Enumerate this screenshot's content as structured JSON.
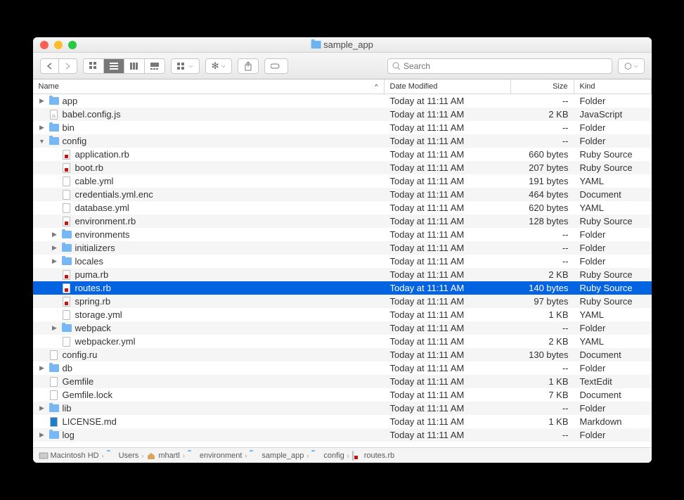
{
  "title": "sample_app",
  "search_placeholder": "Search",
  "columns": {
    "name": "Name",
    "date": "Date Modified",
    "size": "Size",
    "kind": "Kind"
  },
  "path": [
    {
      "label": "Macintosh HD",
      "icon": "disk"
    },
    {
      "label": "Users",
      "icon": "folder"
    },
    {
      "label": "mhartl",
      "icon": "home"
    },
    {
      "label": "environment",
      "icon": "folder"
    },
    {
      "label": "sample_app",
      "icon": "folder"
    },
    {
      "label": "config",
      "icon": "folder"
    },
    {
      "label": "routes.rb",
      "icon": "ruby"
    }
  ],
  "files": [
    {
      "depth": 0,
      "disc": "right",
      "icon": "folder",
      "name": "app",
      "date": "Today at 11:11 AM",
      "size": "--",
      "kind": "Folder"
    },
    {
      "depth": 0,
      "disc": "",
      "icon": "js",
      "name": "babel.config.js",
      "date": "Today at 11:11 AM",
      "size": "2 KB",
      "kind": "JavaScript"
    },
    {
      "depth": 0,
      "disc": "right",
      "icon": "folder",
      "name": "bin",
      "date": "Today at 11:11 AM",
      "size": "--",
      "kind": "Folder"
    },
    {
      "depth": 0,
      "disc": "down",
      "icon": "folder",
      "name": "config",
      "date": "Today at 11:11 AM",
      "size": "--",
      "kind": "Folder"
    },
    {
      "depth": 1,
      "disc": "",
      "icon": "ruby",
      "name": "application.rb",
      "date": "Today at 11:11 AM",
      "size": "660 bytes",
      "kind": "Ruby Source"
    },
    {
      "depth": 1,
      "disc": "",
      "icon": "ruby",
      "name": "boot.rb",
      "date": "Today at 11:11 AM",
      "size": "207 bytes",
      "kind": "Ruby Source"
    },
    {
      "depth": 1,
      "disc": "",
      "icon": "file",
      "name": "cable.yml",
      "date": "Today at 11:11 AM",
      "size": "191 bytes",
      "kind": "YAML"
    },
    {
      "depth": 1,
      "disc": "",
      "icon": "file",
      "name": "credentials.yml.enc",
      "date": "Today at 11:11 AM",
      "size": "464 bytes",
      "kind": "Document"
    },
    {
      "depth": 1,
      "disc": "",
      "icon": "file",
      "name": "database.yml",
      "date": "Today at 11:11 AM",
      "size": "620 bytes",
      "kind": "YAML"
    },
    {
      "depth": 1,
      "disc": "",
      "icon": "ruby",
      "name": "environment.rb",
      "date": "Today at 11:11 AM",
      "size": "128 bytes",
      "kind": "Ruby Source"
    },
    {
      "depth": 1,
      "disc": "right",
      "icon": "folder",
      "name": "environments",
      "date": "Today at 11:11 AM",
      "size": "--",
      "kind": "Folder"
    },
    {
      "depth": 1,
      "disc": "right",
      "icon": "folder",
      "name": "initializers",
      "date": "Today at 11:11 AM",
      "size": "--",
      "kind": "Folder"
    },
    {
      "depth": 1,
      "disc": "right",
      "icon": "folder",
      "name": "locales",
      "date": "Today at 11:11 AM",
      "size": "--",
      "kind": "Folder"
    },
    {
      "depth": 1,
      "disc": "",
      "icon": "ruby",
      "name": "puma.rb",
      "date": "Today at 11:11 AM",
      "size": "2 KB",
      "kind": "Ruby Source"
    },
    {
      "depth": 1,
      "disc": "",
      "icon": "ruby",
      "name": "routes.rb",
      "date": "Today at 11:11 AM",
      "size": "140 bytes",
      "kind": "Ruby Source",
      "selected": true
    },
    {
      "depth": 1,
      "disc": "",
      "icon": "ruby",
      "name": "spring.rb",
      "date": "Today at 11:11 AM",
      "size": "97 bytes",
      "kind": "Ruby Source"
    },
    {
      "depth": 1,
      "disc": "",
      "icon": "file",
      "name": "storage.yml",
      "date": "Today at 11:11 AM",
      "size": "1 KB",
      "kind": "YAML"
    },
    {
      "depth": 1,
      "disc": "right",
      "icon": "folder",
      "name": "webpack",
      "date": "Today at 11:11 AM",
      "size": "--",
      "kind": "Folder"
    },
    {
      "depth": 1,
      "disc": "",
      "icon": "file",
      "name": "webpacker.yml",
      "date": "Today at 11:11 AM",
      "size": "2 KB",
      "kind": "YAML"
    },
    {
      "depth": 0,
      "disc": "",
      "icon": "file",
      "name": "config.ru",
      "date": "Today at 11:11 AM",
      "size": "130 bytes",
      "kind": "Document"
    },
    {
      "depth": 0,
      "disc": "right",
      "icon": "folder",
      "name": "db",
      "date": "Today at 11:11 AM",
      "size": "--",
      "kind": "Folder"
    },
    {
      "depth": 0,
      "disc": "",
      "icon": "file",
      "name": "Gemfile",
      "date": "Today at 11:11 AM",
      "size": "1 KB",
      "kind": "TextEdit"
    },
    {
      "depth": 0,
      "disc": "",
      "icon": "file",
      "name": "Gemfile.lock",
      "date": "Today at 11:11 AM",
      "size": "7 KB",
      "kind": "Document"
    },
    {
      "depth": 0,
      "disc": "right",
      "icon": "folder",
      "name": "lib",
      "date": "Today at 11:11 AM",
      "size": "--",
      "kind": "Folder"
    },
    {
      "depth": 0,
      "disc": "",
      "icon": "md",
      "name": "LICENSE.md",
      "date": "Today at 11:11 AM",
      "size": "1 KB",
      "kind": "Markdown"
    },
    {
      "depth": 0,
      "disc": "right",
      "icon": "folder",
      "name": "log",
      "date": "Today at 11:11 AM",
      "size": "--",
      "kind": "Folder"
    }
  ]
}
